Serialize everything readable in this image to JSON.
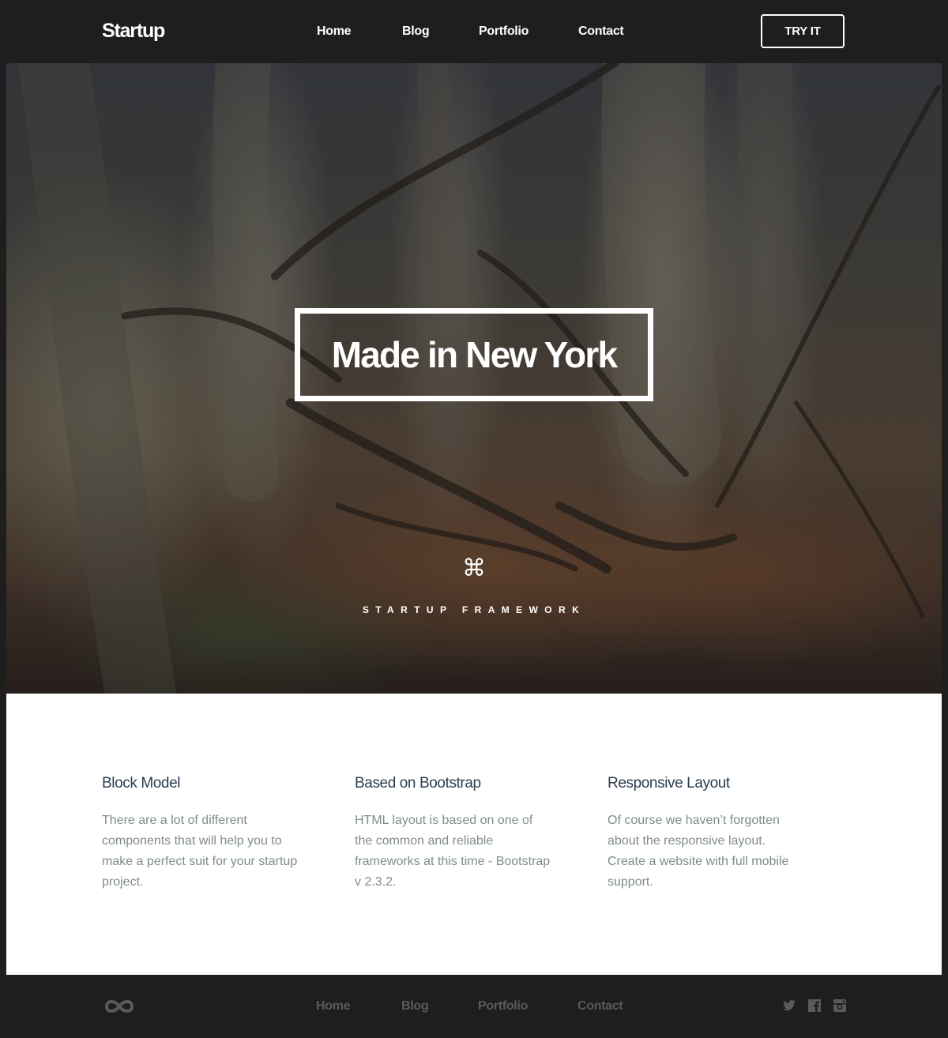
{
  "header": {
    "logo": "Startup",
    "nav": [
      "Home",
      "Blog",
      "Portfolio",
      "Contact"
    ],
    "cta_label": "TRY IT"
  },
  "hero": {
    "headline": "Made in New York",
    "icon": "command-icon",
    "icon_glyph": "⌘",
    "tagline": "STARTUP FRAMEWORK"
  },
  "features": [
    {
      "title": "Block Model",
      "text": "There are a lot of different components that will help you to make a perfect suit for your startup project."
    },
    {
      "title": "Based on Bootstrap",
      "text": "HTML layout is based on one of the common and reliable frameworks at this time - Bootstrap v 2.3.2."
    },
    {
      "title": "Responsive Layout",
      "text": "Of course we haven’t forgotten about the responsive layout. Create a website with full mobile support."
    }
  ],
  "footer": {
    "logo_icon": "infinity-icon",
    "nav": [
      "Home",
      "Blog",
      "Portfolio",
      "Contact"
    ],
    "social": [
      "twitter-icon",
      "facebook-icon",
      "instagram-icon"
    ]
  },
  "colors": {
    "dark_bg": "#1e1e1e",
    "heading": "#2c3e50",
    "body_text": "#7f8c8d",
    "footer_link": "#5a5a5a"
  }
}
